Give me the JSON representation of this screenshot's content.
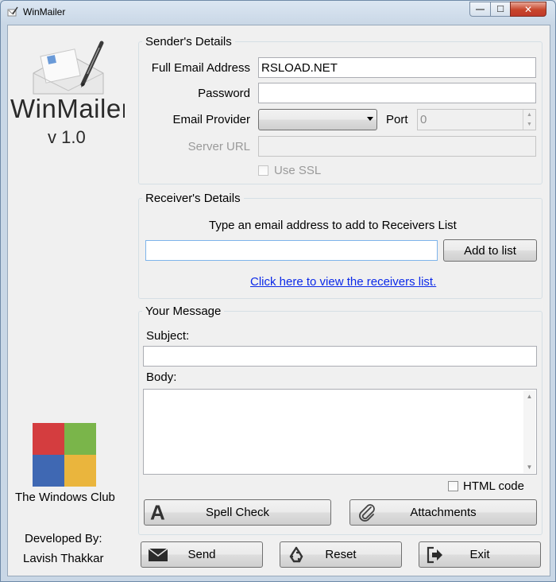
{
  "window": {
    "title": "WinMailer",
    "controls": [
      "minimize",
      "maximize",
      "close"
    ]
  },
  "sidebar": {
    "app_name": "WinMailer",
    "version": "v 1.0",
    "club_name": "The Windows Club",
    "dev_label": "Developed By:",
    "dev_name": "Lavish Thakkar",
    "logo_colors": [
      "#d43d3f",
      "#7ab54a",
      "#3f68b3",
      "#eab53d"
    ]
  },
  "sender": {
    "legend": "Sender's Details",
    "email_label": "Full Email Address",
    "email_value": "RSLOAD.NET",
    "password_label": "Password",
    "password_value": "",
    "provider_label": "Email Provider",
    "provider_value": "",
    "port_label": "Port",
    "port_value": "0",
    "server_label": "Server URL",
    "server_value": "",
    "ssl_label": "Use SSL"
  },
  "receiver": {
    "legend": "Receiver's Details",
    "prompt": "Type an email address to add to Receivers List",
    "email_value": "",
    "add_button": "Add to list",
    "view_link": "Click here to view the receivers list."
  },
  "message": {
    "legend": "Your Message",
    "subject_label": "Subject:",
    "subject_value": "",
    "body_label": "Body:",
    "body_value": "",
    "html_label": "HTML code",
    "spell_button": "Spell Check",
    "attach_button": "Attachments"
  },
  "actions": {
    "send": "Send",
    "reset": "Reset",
    "exit": "Exit"
  }
}
